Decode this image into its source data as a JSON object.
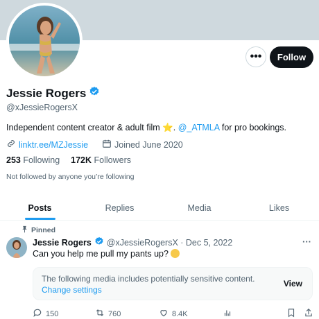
{
  "profile": {
    "display_name": "Jessie Rogers",
    "handle": "@xJessieRogersX",
    "bio_text": "Independent content creator & adult film",
    "bio_star": "⭐",
    "bio_sep": ".",
    "bio_mention": "@_ATMLA",
    "bio_end": "for pro bookings.",
    "link": "linktr.ee/MZJessie",
    "joined": "Joined June 2020",
    "following_count": "253",
    "following_label": "Following",
    "followers_count": "172K",
    "followers_label": "Followers",
    "not_followed": "Not followed by anyone you’re following"
  },
  "actions": {
    "more_label": "•••",
    "follow_label": "Follow"
  },
  "tabs": [
    {
      "label": "Posts",
      "active": true
    },
    {
      "label": "Replies"
    },
    {
      "label": "Media"
    },
    {
      "label": "Likes"
    }
  ],
  "tweet": {
    "pinned_label": "Pinned",
    "name": "Jessie Rogers",
    "handle_date": "@xJessieRogersX · Dec 5, 2022",
    "more": "···",
    "text": "Can you help me pull my pants up?",
    "sensitive_text": "The following media includes potentially sensitive content.",
    "sensitive_link": "Change settings",
    "view_label": "View",
    "replies": "150",
    "reposts": "760",
    "likes": "8.4K"
  },
  "colors": {
    "accent": "#1d9bf0",
    "banner": "#cfd9de",
    "text_secondary": "#536471"
  }
}
